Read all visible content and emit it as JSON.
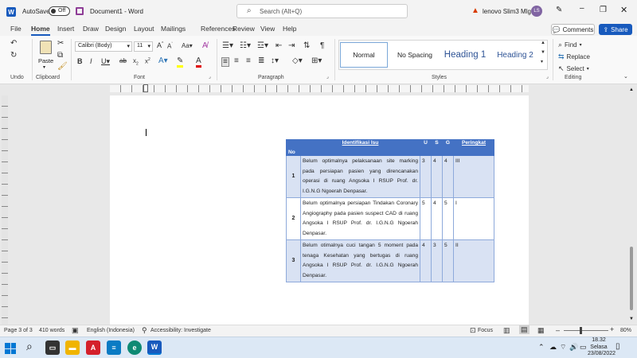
{
  "titlebar": {
    "autosave_label": "AutoSave",
    "autosave_state": "Off",
    "doc_title": "Document1 - Word",
    "search_placeholder": "Search (Alt+Q)",
    "account_name": "lenovo Slim3 Mlg",
    "account_initials": "LS"
  },
  "menu": {
    "tabs": [
      "File",
      "Home",
      "Insert",
      "Draw",
      "Design",
      "Layout",
      "Mailings",
      "References",
      "Review",
      "View",
      "Help"
    ],
    "comments_label": "Comments",
    "share_label": "Share"
  },
  "ribbon": {
    "undo_label": "Undo",
    "clipboard_label": "Clipboard",
    "paste_label": "Paste",
    "font_label": "Font",
    "font_name": "Calibri (Body)",
    "font_size": "11",
    "paragraph_label": "Paragraph",
    "styles_label": "Styles",
    "editing_label": "Editing",
    "styles": [
      "Normal",
      "No Spacing",
      "Heading 1",
      "Heading 2"
    ],
    "find_label": "Find",
    "replace_label": "Replace",
    "select_label": "Select"
  },
  "table": {
    "headers": [
      "No",
      "Identifikasi Isu",
      "U",
      "S",
      "G",
      "Peringkat"
    ],
    "rows": [
      {
        "no": "1",
        "desc": "Belum optimalnya pelaksanaan site marking pada persiapan pasien yang direncanakan operasi di ruang Angsoka I RSUP Prof. dr. I.G.N.G Ngoerah Denpasar.",
        "u": "3",
        "s": "4",
        "g": "4",
        "rank": "III"
      },
      {
        "no": "2",
        "desc": "Belum optimalnya persiapan Tindakan Coronary Angiography pada pasien suspect CAD di ruang Angsoka I RSUP Prof. dr. I.G.N.G Ngoerah Denpasar.",
        "u": "5",
        "s": "4",
        "g": "5",
        "rank": "I"
      },
      {
        "no": "3",
        "desc": "Belum otimalnya cuci tangan 5 moment pada tenaga Kesehatan yang bertugas di ruang Angsoka I RSUP Prof. dr. I.G.N.G Ngoerah Denpasar.",
        "u": "4",
        "s": "3",
        "g": "5",
        "rank": "II"
      }
    ]
  },
  "status": {
    "page": "Page 3 of 3",
    "words": "410 words",
    "language": "English (Indonesia)",
    "accessibility": "Accessibility: Investigate",
    "focus": "Focus",
    "zoom": "80%"
  },
  "taskbar": {
    "time": "18.32",
    "day": "Selasa",
    "date": "23/08/2022"
  },
  "colors": {
    "header_blue": "#4472c4",
    "band_blue": "#d9e2f3",
    "share_blue": "#185abd"
  }
}
